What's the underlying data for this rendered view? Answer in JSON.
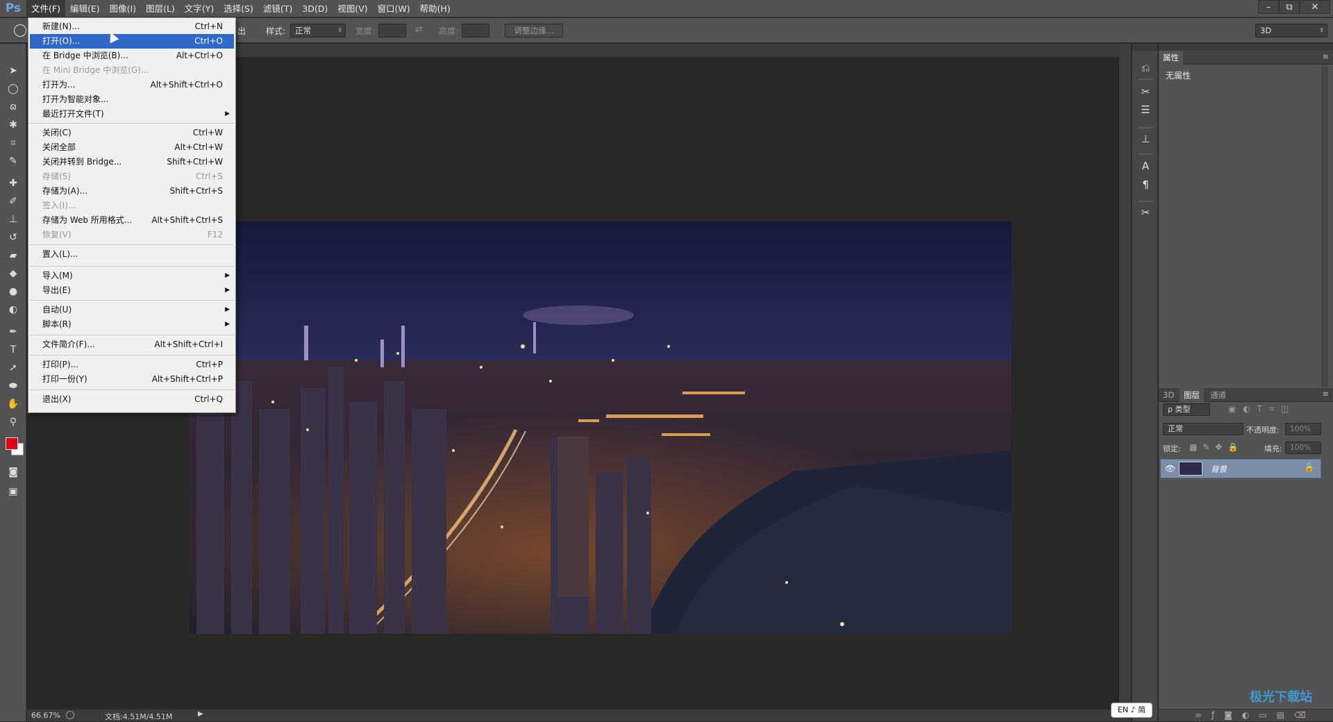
{
  "app": {
    "logo": "Ps"
  },
  "menubar": {
    "items": [
      "文件(F)",
      "编辑(E)",
      "图像(I)",
      "图层(L)",
      "文字(Y)",
      "选择(S)",
      "滤镜(T)",
      "3D(D)",
      "视图(V)",
      "窗口(W)",
      "帮助(H)"
    ],
    "window_controls": {
      "minimize": "–",
      "restore": "⧉",
      "close": "✕"
    }
  },
  "options": {
    "partial_label": "出",
    "style_label": "样式:",
    "style_value": "正常",
    "width_label": "宽度:",
    "height_label": "高度:",
    "refine_edge": "调整边缘...",
    "workspace": "3D"
  },
  "file_menu": {
    "items": [
      {
        "label": "新建(N)...",
        "shortcut": "Ctrl+N",
        "disabled": false
      },
      {
        "label": "打开(O)...",
        "shortcut": "Ctrl+O",
        "disabled": false,
        "hover": true
      },
      {
        "label": "在 Bridge 中浏览(B)...",
        "shortcut": "Alt+Ctrl+O",
        "disabled": false
      },
      {
        "label": "在 Mini Bridge 中浏览(G)...",
        "shortcut": "",
        "disabled": true
      },
      {
        "label": "打开为...",
        "shortcut": "Alt+Shift+Ctrl+O",
        "disabled": false
      },
      {
        "label": "打开为智能对象...",
        "shortcut": "",
        "disabled": false
      },
      {
        "label": "最近打开文件(T)",
        "shortcut": "",
        "disabled": false,
        "submenu": true
      },
      {
        "label": "关闭(C)",
        "shortcut": "Ctrl+W",
        "disabled": false
      },
      {
        "label": "关闭全部",
        "shortcut": "Alt+Ctrl+W",
        "disabled": false
      },
      {
        "label": "关闭并转到 Bridge...",
        "shortcut": "Shift+Ctrl+W",
        "disabled": false
      },
      {
        "label": "存储(S)",
        "shortcut": "Ctrl+S",
        "disabled": true
      },
      {
        "label": "存储为(A)...",
        "shortcut": "Shift+Ctrl+S",
        "disabled": false
      },
      {
        "label": "签入(I)...",
        "shortcut": "",
        "disabled": true
      },
      {
        "label": "存储为 Web 所用格式...",
        "shortcut": "Alt+Shift+Ctrl+S",
        "disabled": false
      },
      {
        "label": "恢复(V)",
        "shortcut": "F12",
        "disabled": true
      },
      {
        "label": "置入(L)...",
        "shortcut": "",
        "disabled": false
      },
      {
        "label": "导入(M)",
        "shortcut": "",
        "disabled": false,
        "submenu": true
      },
      {
        "label": "导出(E)",
        "shortcut": "",
        "disabled": false,
        "submenu": true
      },
      {
        "label": "自动(U)",
        "shortcut": "",
        "disabled": false,
        "submenu": true
      },
      {
        "label": "脚本(R)",
        "shortcut": "",
        "disabled": false,
        "submenu": true
      },
      {
        "label": "文件简介(F)...",
        "shortcut": "Alt+Shift+Ctrl+I",
        "disabled": false
      },
      {
        "label": "打印(P)...",
        "shortcut": "Ctrl+P",
        "disabled": false
      },
      {
        "label": "打印一份(Y)",
        "shortcut": "Alt+Shift+Ctrl+P",
        "disabled": false
      },
      {
        "label": "退出(X)",
        "shortcut": "Ctrl+Q",
        "disabled": false
      }
    ]
  },
  "status": {
    "zoom": "66.67%",
    "doc_info": "文档:4.51M/4.51M"
  },
  "properties_panel": {
    "tab": "属性",
    "content": "无属性"
  },
  "layers_panel": {
    "tabs": [
      "3D",
      "图层",
      "通道"
    ],
    "filter": "ρ 类型",
    "blend_mode": "正常",
    "opacity_label": "不透明度:",
    "opacity_value": "100%",
    "lock_label": "锁定:",
    "fill_label": "填充:",
    "fill_value": "100%",
    "layer_name": "背景"
  },
  "ime": {
    "label": "EN ♪ 简"
  },
  "watermark": {
    "text": "极光下载站"
  }
}
